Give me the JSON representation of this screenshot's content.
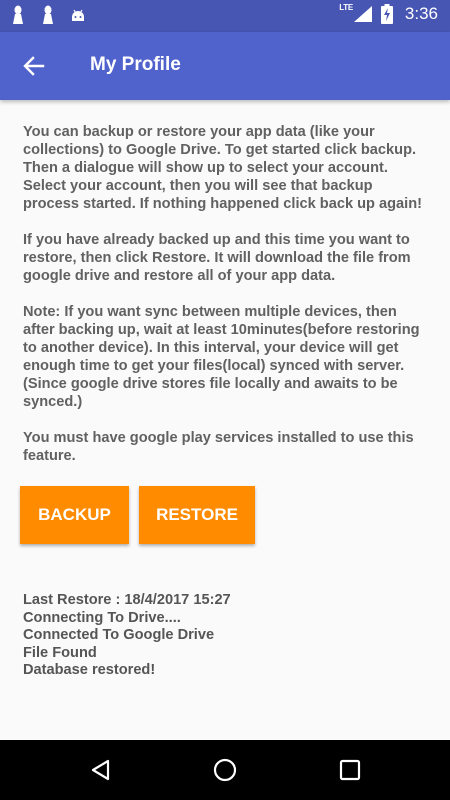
{
  "status_bar": {
    "network_label": "LTE",
    "time": "3:36",
    "icons": [
      "notification-icon",
      "notification-icon",
      "android-icon",
      "signal-icon",
      "battery-charging-icon"
    ]
  },
  "app_bar": {
    "title": "My Profile",
    "back_icon": "arrow-back-icon",
    "background": "#5062cc"
  },
  "content": {
    "paragraphs": [
      "You can backup or restore your app data (like your collections) to Google Drive. To get started click backup. Then a dialogue will show up to select your account. Select your account, then you will see that backup process started. If nothing happened click back up again!",
      "If you have already backed up and this time you want to restore, then click Restore. It will download the file from google drive and restore all of your app data.",
      "Note: If you want sync between multiple devices, then after backing up, wait at least 10minutes(before restoring to another device). In this interval, your device will get enough time to get your files(local) synced with server. (Since google drive stores file locally and awaits to be synced.)",
      "You must have google play services installed to use this feature."
    ]
  },
  "buttons": {
    "backup_label": "BACKUP",
    "restore_label": "RESTORE",
    "color": "#ff8c00"
  },
  "log": {
    "lines": [
      "Last Restore : 18/4/2017 15:27",
      "Connecting To Drive....",
      "Connected To Google Drive",
      "File Found",
      "Database restored!"
    ]
  },
  "nav_bar": {
    "icons": [
      "nav-back-icon",
      "nav-home-icon",
      "nav-recents-icon"
    ]
  }
}
